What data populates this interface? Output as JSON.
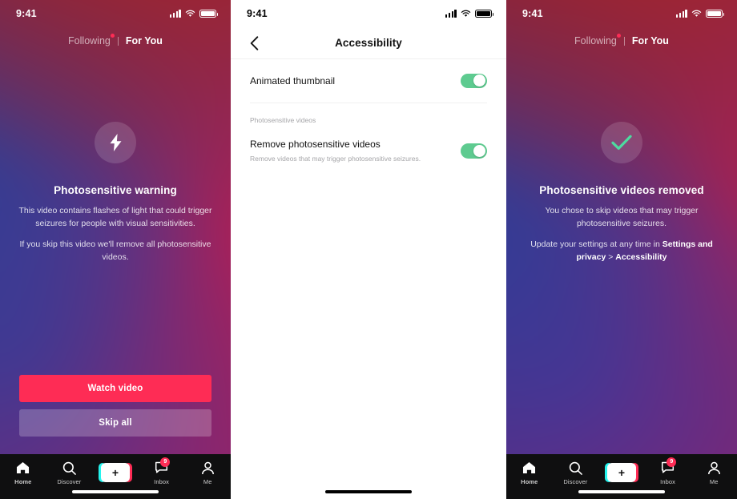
{
  "panels": {
    "left": {
      "status_bar": {
        "time": "9:41",
        "signal_icon": "cellular-signal-icon",
        "wifi_icon": "wifi-icon",
        "battery_icon": "battery-icon"
      },
      "feed_tabs": [
        {
          "label": "Following",
          "active": false,
          "has_dot": true
        },
        {
          "label": "For You",
          "active": true,
          "has_dot": false
        }
      ],
      "overlay": {
        "icon": "lightning-bolt-icon",
        "title": "Photosensitive warning",
        "paragraph_1": "This video contains flashes of light that could trigger seizures for people with visual sensitivities.",
        "paragraph_2": "If you skip this video we'll remove all photosensitive videos."
      },
      "actions": {
        "primary_label": "Watch video",
        "secondary_label": "Skip all"
      }
    },
    "middle": {
      "status_bar": {
        "time": "9:41",
        "signal_icon": "cellular-signal-icon",
        "wifi_icon": "wifi-icon",
        "battery_icon": "battery-icon"
      },
      "nav": {
        "back_icon": "chevron-left-icon",
        "title": "Accessibility"
      },
      "rows": [
        {
          "title": "Animated thumbnail",
          "subtitle": "",
          "toggle": "on"
        }
      ],
      "section_label": "Photosensitive videos",
      "rows2": [
        {
          "title": "Remove photosensitive videos",
          "subtitle": "Remove videos that may trigger photosensitive seizures.",
          "toggle": "on"
        }
      ]
    },
    "right": {
      "status_bar": {
        "time": "9:41",
        "signal_icon": "cellular-signal-icon",
        "wifi_icon": "wifi-icon",
        "battery_icon": "battery-icon"
      },
      "feed_tabs": [
        {
          "label": "Following",
          "active": false,
          "has_dot": true
        },
        {
          "label": "For You",
          "active": true,
          "has_dot": false
        }
      ],
      "overlay": {
        "icon": "checkmark-icon",
        "title": "Photosensitive videos removed",
        "paragraph_1": "You chose to skip videos that may trigger photosensitive seizures.",
        "paragraph_2_prefix": "Update your settings at any time in ",
        "paragraph_2_bold_1": "Settings and privacy",
        "paragraph_2_mid": " > ",
        "paragraph_2_bold_2": "Accessibility"
      }
    }
  },
  "tabbar": {
    "items": [
      {
        "label": "Home",
        "icon": "home-icon"
      },
      {
        "label": "Discover",
        "icon": "search-icon"
      },
      {
        "label": "",
        "icon": "create-plus-icon"
      },
      {
        "label": "Inbox",
        "icon": "inbox-icon",
        "badge": "9"
      },
      {
        "label": "Me",
        "icon": "profile-icon"
      }
    ],
    "create_glyph": "+"
  },
  "colors": {
    "accent_red": "#fe2c55",
    "accent_cyan": "#25f4ee",
    "toggle_green": "#5ecb90",
    "check_green": "#4ddba0",
    "tabbar_bg": "#0f0f10"
  }
}
